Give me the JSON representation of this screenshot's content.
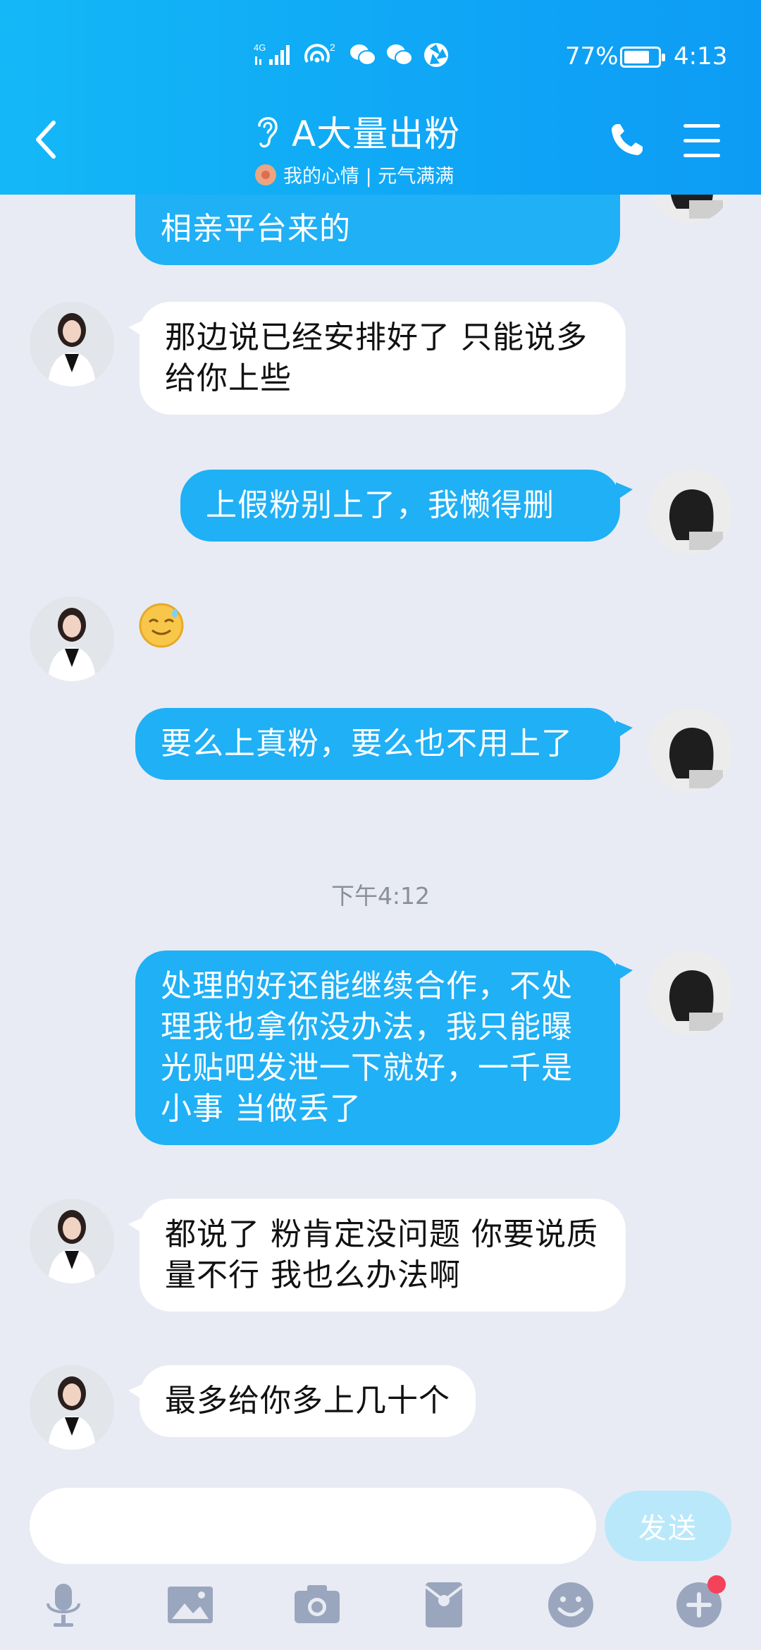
{
  "status_bar": {
    "network": "4G",
    "hotspot_count": "2",
    "battery_percent": "77%",
    "battery_level": 0.77,
    "time": "4:13"
  },
  "header": {
    "title": "A大量出粉",
    "subtitle": "我的心情 | 元气满满"
  },
  "messages": [
    {
      "side": "out",
      "text": "相亲平台来的",
      "partial": true
    },
    {
      "side": "in",
      "text": "那边说已经安排好了 只能说多给你上些"
    },
    {
      "side": "out",
      "text": "上假粉别上了，我懒得删"
    },
    {
      "side": "in",
      "type": "emoji",
      "icon": "sweat-smile-emoji"
    },
    {
      "side": "out",
      "text": "要么上真粉，要么也不用上了"
    },
    {
      "type": "time",
      "text": "下午4:12"
    },
    {
      "side": "out",
      "text": "处理的好还能继续合作，不处理我也拿你没办法，我只能曝光贴吧发泄一下就好，一千是小事 当做丢了"
    },
    {
      "side": "in",
      "text": "都说了 粉肯定没问题 你要说质量不行 我也么办法啊"
    },
    {
      "side": "in",
      "text": "最多给你多上几十个"
    }
  ],
  "composer": {
    "input_value": "",
    "send_label": "发送",
    "tools": [
      "microphone-icon",
      "image-icon",
      "camera-icon",
      "red-packet-icon",
      "emoji-icon",
      "plus-icon"
    ],
    "plus_badge": true
  },
  "colors": {
    "header": "#0fa6f6",
    "outgoing_bubble": "#1fb0f6",
    "incoming_bubble": "#ffffff",
    "background": "#e8ebf3",
    "send_disabled": "#b9e8fb",
    "badge": "#f4425b"
  }
}
